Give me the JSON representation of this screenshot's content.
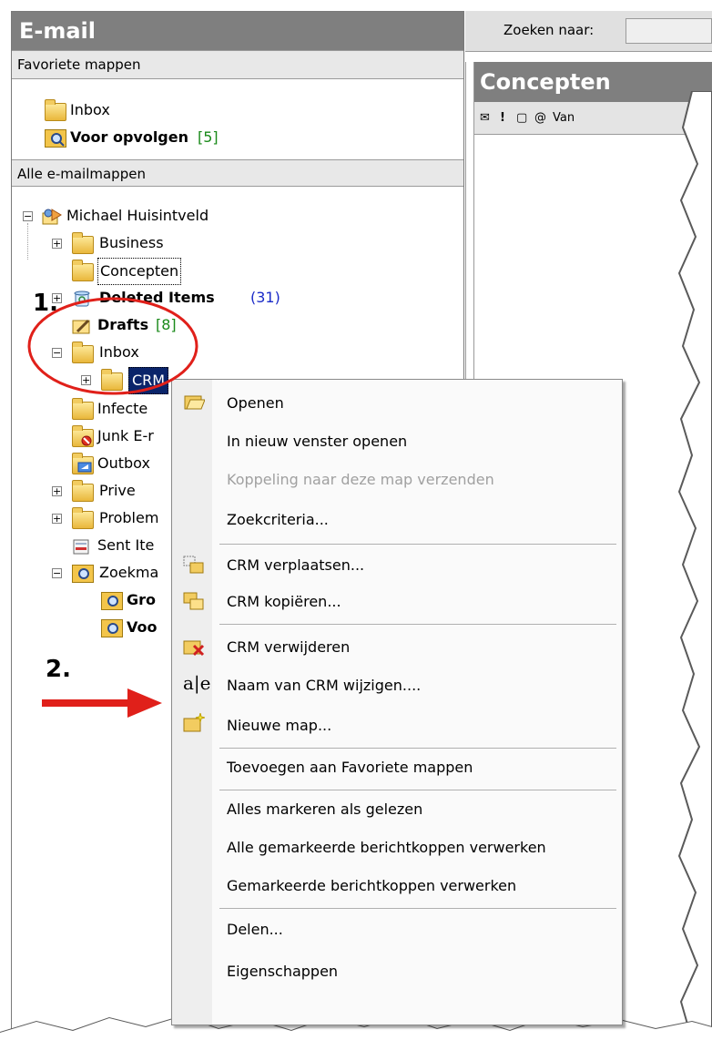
{
  "nav": {
    "title": "E-mail",
    "favorites_header": "Favoriete mappen",
    "favorites": [
      {
        "label": "Inbox",
        "bold": false
      },
      {
        "label": "Voor opvolgen",
        "count": "[5]",
        "bold": true
      }
    ],
    "all_header": "Alle e-mailmappen",
    "root": "Michael Huisintveld",
    "tree": {
      "business": "Business",
      "concepten": "Concepten",
      "deleted": "Deleted Items",
      "deleted_count": "(31)",
      "drafts": "Drafts",
      "drafts_count": "[8]",
      "inbox": "Inbox",
      "crm": "CRM",
      "infected": "Infecte",
      "junk": "Junk E-r",
      "outbox": "Outbox",
      "prive": "Prive",
      "problem": "Problem",
      "sent": "Sent Ite",
      "zoekmappen": "Zoekma",
      "search_1": "Gro",
      "search_2": "Voo"
    }
  },
  "right": {
    "search_label": "Zoeken naar:",
    "folder_title": "Concepten",
    "column_van": "Van"
  },
  "context_menu": {
    "items": [
      {
        "label": "Openen",
        "disabled": false
      },
      {
        "label": "In nieuw venster openen",
        "disabled": false
      },
      {
        "label": "Koppeling naar deze map verzenden",
        "disabled": true
      },
      {
        "label": "Zoekcriteria...",
        "disabled": false
      },
      {
        "label": "CRM verplaatsen...",
        "disabled": false
      },
      {
        "label": "CRM kopiëren...",
        "disabled": false
      },
      {
        "label": "CRM verwijderen",
        "disabled": false
      },
      {
        "label": "Naam van CRM wijzigen....",
        "disabled": false
      },
      {
        "label": "Nieuwe map...",
        "disabled": false
      },
      {
        "label": "Toevoegen aan Favoriete mappen",
        "disabled": false
      },
      {
        "label": "Alles markeren als gelezen",
        "disabled": false
      },
      {
        "label": "Alle gemarkeerde berichtkoppen verwerken",
        "disabled": false
      },
      {
        "label": "Gemarkeerde berichtkoppen verwerken",
        "disabled": false
      },
      {
        "label": "Delen...",
        "disabled": false
      },
      {
        "label": "Eigenschappen",
        "disabled": false
      }
    ]
  },
  "annotations": {
    "step1": "1.",
    "step2": "2."
  },
  "colors": {
    "header_gray": "#7f7f7f",
    "selection_blue": "#0a246a",
    "annotation_red": "#e0201a",
    "count_green": "#1a8a1a",
    "count_blue": "#1a2ac8"
  },
  "icons": [
    "folder-icon",
    "search-folder-icon",
    "inbox-icon",
    "trash-icon",
    "drafts-icon",
    "junk-icon",
    "outbox-icon",
    "sent-icon",
    "mailbox-root-icon",
    "open-folder-icon",
    "move-icon",
    "copy-icon",
    "delete-folder-icon",
    "rename-icon",
    "new-folder-icon",
    "red-arrow-icon"
  ]
}
